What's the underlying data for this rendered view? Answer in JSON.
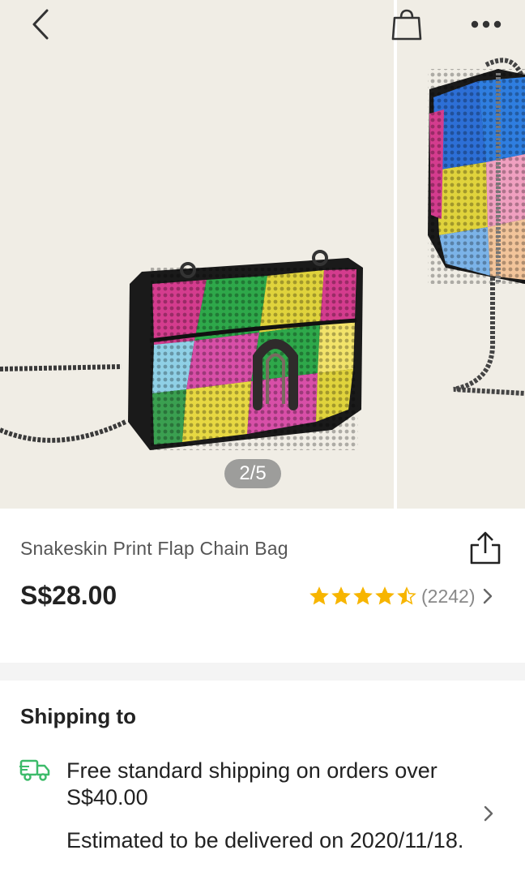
{
  "gallery": {
    "counter": "2/5"
  },
  "product": {
    "title": "Snakeskin Print Flap Chain Bag",
    "price": "S$28.00",
    "rating_stars": 4.5,
    "review_count": "(2242)"
  },
  "shipping": {
    "heading": "Shipping to",
    "free_line": "Free standard shipping on orders over S$40.00",
    "estimate_line": "Estimated to be delivered on 2020/11/18."
  },
  "colors": {
    "star": "#f7b500",
    "truck": "#3dbb6a",
    "gallery_bg": "#f0ede5"
  },
  "icons": [
    "back-icon",
    "bag-icon",
    "more-icon",
    "share-icon",
    "star-icon",
    "chevron-right-icon",
    "truck-icon"
  ]
}
